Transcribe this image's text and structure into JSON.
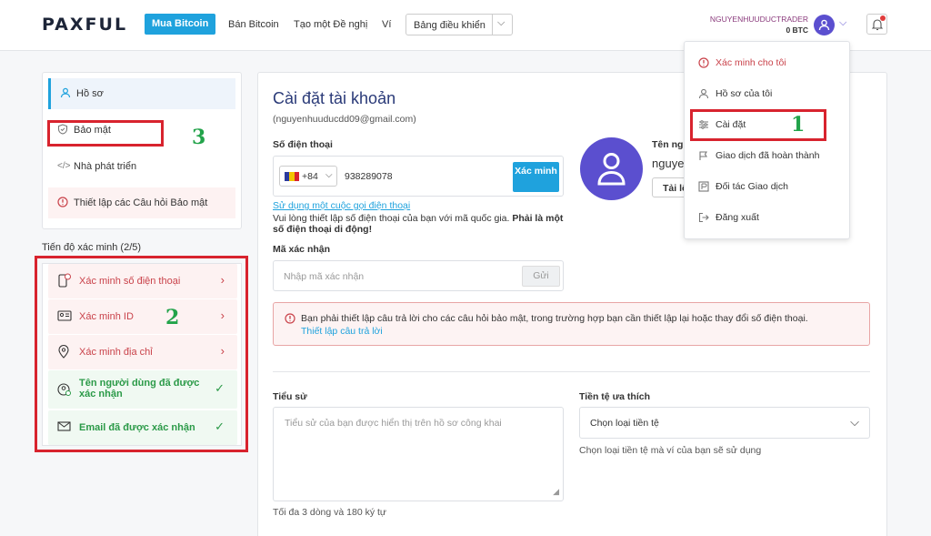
{
  "header": {
    "logo": "PAXFUL",
    "nav_buy": "Mua Bitcoin",
    "nav_sell": "Bán Bitcoin",
    "nav_offer": "Tạo một Đề nghị",
    "nav_wallet": "Ví",
    "dashboard_label": "Bảng điều khiển",
    "username": "NGUYENHUUDUCTRADER",
    "balance": "0 BTC"
  },
  "sidebar": {
    "items": [
      {
        "label": "Hồ sơ"
      },
      {
        "label": "Bảo mật"
      },
      {
        "label": "Nhà phát triển"
      },
      {
        "label": "Thiết lập các Câu hỏi Bảo mật"
      }
    ]
  },
  "verification": {
    "title": "Tiến độ xác minh (2/5)",
    "items": [
      {
        "label": "Xác minh số điện thoại",
        "status": "pending"
      },
      {
        "label": "Xác minh ID",
        "status": "pending"
      },
      {
        "label": "Xác minh địa chỉ",
        "status": "pending"
      },
      {
        "label": "Tên người dùng đã được xác nhận",
        "status": "done"
      },
      {
        "label": "Email đã được xác nhận",
        "status": "done"
      }
    ]
  },
  "main": {
    "title": "Cài đặt tài khoản",
    "email": "(nguyenhuuducdd09@gmail.com)",
    "phone_label": "Số điện thoại",
    "country_code": "+84",
    "phone_value": "938289078",
    "verify_btn": "Xác minh",
    "call_link": "Sử dụng một cuộc gọi điện thoại",
    "note_text": "Vui lòng thiết lập số điện thoại của bạn với mã quốc gia. ",
    "note_bold": "Phải là một số điện thoại di động!",
    "code_label": "Mã xác nhận",
    "code_placeholder": "Nhập mã xác nhận",
    "send_btn": "Gửi",
    "username_label": "Tên ngư",
    "username_value": "nguye",
    "upload_btn": "Tải lê",
    "alert_text": "Bạn phải thiết lập câu trả lời cho các câu hỏi bảo mật, trong trường hợp bạn cần thiết lập lại hoặc thay đổi số điện thoại.",
    "alert_link": "Thiết lập câu trả lời",
    "bio_label": "Tiểu sử",
    "bio_placeholder": "Tiểu sử của bạn được hiển thị trên hồ sơ công khai",
    "bio_hint": "Tối đa 3 dòng và 180 ký tự",
    "currency_label": "Tiền tệ ưa thích",
    "currency_placeholder": "Chọn loại tiền tệ",
    "currency_hint": "Chọn loại tiền tệ mà ví của bạn sẽ sử dụng"
  },
  "dropdown": {
    "items": [
      {
        "label": "Xác minh cho tôi",
        "icon": "alert-circle-icon"
      },
      {
        "label": "Hồ sơ của tôi",
        "icon": "user-icon"
      },
      {
        "label": "Cài đặt",
        "icon": "sliders-icon"
      },
      {
        "label": "Giao dịch đã hoàn thành",
        "icon": "flag-icon"
      },
      {
        "label": "Đối tác Giao dịch",
        "icon": "partner-icon"
      },
      {
        "label": "Đăng xuất",
        "icon": "logout-icon"
      }
    ]
  },
  "annotations": {
    "n1": "1",
    "n2": "2",
    "n3": "3"
  },
  "colors": {
    "accent": "#1fa2dd",
    "brand_purple": "#5b4fcf",
    "annotation_red": "#d8232e",
    "annotation_green": "#22a34a"
  }
}
